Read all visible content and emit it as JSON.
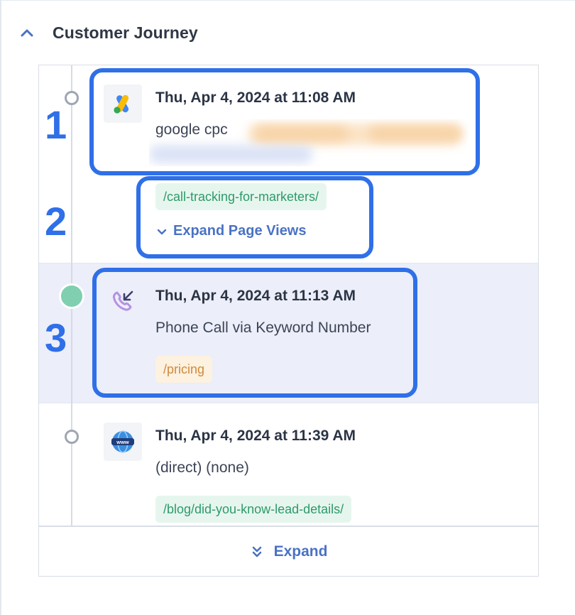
{
  "section": {
    "title": "Customer Journey",
    "collapse_icon": "chevron-up-icon"
  },
  "steps": [
    {
      "number": "1",
      "icon": "google-ads-icon",
      "time": "Thu, Apr 4, 2024 at 11:08 AM",
      "description": "google cpc",
      "url": "/call-tracking-for-marketers/",
      "url_color": "green"
    },
    {
      "number": "2",
      "expand_page_views": "Expand Page Views"
    },
    {
      "number": "3",
      "icon": "phone-incoming-icon",
      "time": "Thu, Apr 4, 2024 at 11:13 AM",
      "description": "Phone Call via Keyword Number",
      "url": "/pricing",
      "url_color": "orange"
    },
    {
      "icon": "www-globe-icon",
      "time": "Thu, Apr 4, 2024 at 11:39 AM",
      "description": "(direct) (none)",
      "url": "/blog/did-you-know-lead-details/",
      "url_color": "green"
    }
  ],
  "footer": {
    "expand_label": "Expand",
    "expand_icon": "double-chevron-down-icon"
  },
  "colors": {
    "annotation_blue": "#2f6fe8",
    "link_blue": "#4a72c4",
    "url_green": "#2e9a68",
    "url_orange": "#cf8a3b",
    "call_dot": "#7fcfb0",
    "highlight_row": "#eceef9"
  }
}
